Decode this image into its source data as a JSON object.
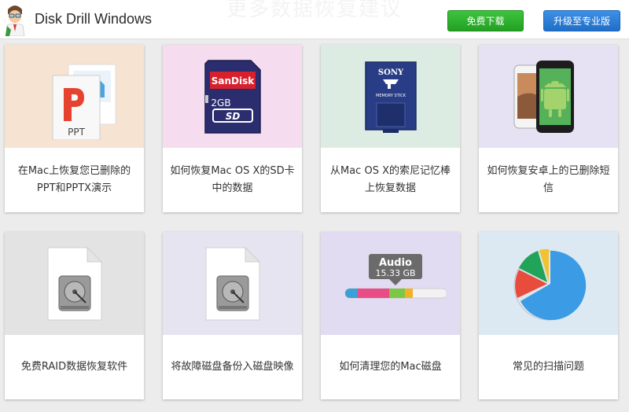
{
  "header": {
    "app_title": "Disk Drill Windows",
    "background_title": "更多数据恢复建议",
    "download_button": "免费下载",
    "upgrade_button": "升级至专业版"
  },
  "cards": [
    {
      "caption": "在Mac上恢复您已删除的PPT和PPTX演示",
      "icon": "powerpoint-document-icon",
      "bg": "#f6e3d2",
      "image_text": "PPT"
    },
    {
      "caption": "如何恢复Mac OS X的SD卡中的数据",
      "icon": "sd-card-icon",
      "bg": "#f5dcee",
      "image_text": "SanDisk",
      "image_text2": "2GB"
    },
    {
      "caption": "从Mac OS X的索尼记忆棒上恢复数据",
      "icon": "memory-stick-icon",
      "bg": "#dcece3",
      "image_text": "SONY",
      "image_text2": "MEMORY STICK"
    },
    {
      "caption": "如何恢复安卓上的已删除短信",
      "icon": "android-phones-icon",
      "bg": "#e6e1f3"
    },
    {
      "caption": "免费RAID数据恢复软件",
      "icon": "hard-drive-document-icon",
      "bg": "#e3e3e3"
    },
    {
      "caption": "将故障磁盘备份入磁盘映像",
      "icon": "disk-image-icon",
      "bg": "#e7e4f2"
    },
    {
      "caption": "如何清理您的Mac磁盘",
      "icon": "audio-storage-bar-icon",
      "bg": "#e2dcf2",
      "image_text": "Audio",
      "image_text2": "15.33 GB"
    },
    {
      "caption": "常见的扫描问题",
      "icon": "pie-chart-icon",
      "bg": "#dce9f2"
    }
  ],
  "colors": {
    "download_green": "#2bb02b",
    "upgrade_blue": "#2b7fd6"
  }
}
